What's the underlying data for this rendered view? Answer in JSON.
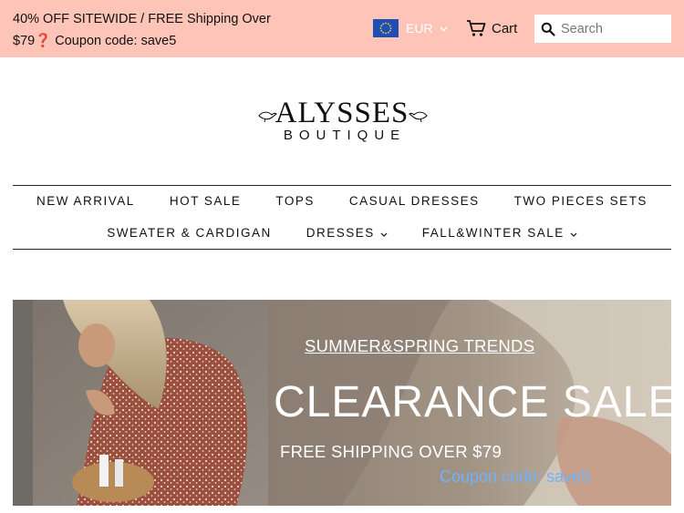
{
  "announcement": {
    "line1": "40% OFF SITEWIDE / FREE Shipping Over",
    "line2": "$79❓ Coupon code: save5"
  },
  "currency": {
    "selected": "EUR",
    "flag_icon": "eu-flag-icon"
  },
  "cart": {
    "label": "Cart",
    "icon": "cart-icon"
  },
  "search": {
    "placeholder": "Search",
    "value": ""
  },
  "logo": {
    "main": "ALYSSES",
    "sub": "BOUTIQUE"
  },
  "nav": {
    "row1": [
      "NEW ARRIVAL",
      "HOT SALE",
      "TOPS",
      "CASUAL DRESSES",
      "TWO PIECES SETS"
    ],
    "row2": [
      "SWEATER & CARDIGAN",
      "DRESSES",
      "FALL&WINTER SALE"
    ]
  },
  "hero": {
    "subtitle": "SUMMER&SPRING TRENDS",
    "title": "CLEARANCE SALE",
    "shipping": "FREE SHIPPING OVER $79",
    "coupon": "Coupon code: save5"
  },
  "colors": {
    "announcement_bg": "#fdc4b7",
    "coupon_text": "#6fb2ff",
    "hero_text": "#ffffff"
  }
}
